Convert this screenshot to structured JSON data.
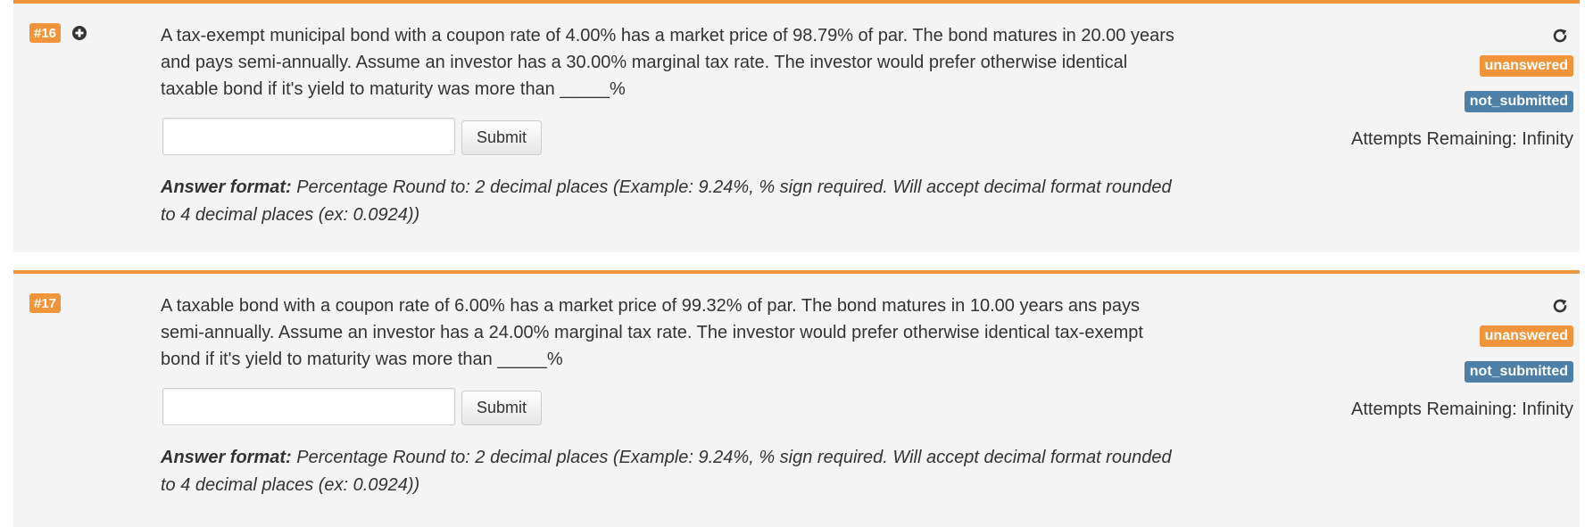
{
  "questions": [
    {
      "number": "#16",
      "text": "A tax-exempt municipal bond with a coupon rate of 4.00% has a market price of 98.79% of par. The bond matures in 20.00 years and pays semi-annually. Assume an investor has a 30.00% marginal tax rate. The investor would prefer otherwise identical taxable bond if it's yield to maturity was more than _____%",
      "answer_value": "",
      "submit_label": "Submit",
      "answer_format_label": "Answer format:",
      "answer_format_text": " Percentage Round to: 2 decimal places (Example: 9.24%, % sign required. Will accept decimal format rounded to 4 decimal places (ex: 0.0924))",
      "status_badge": "unanswered",
      "submission_badge": "not_submitted",
      "attempts": "Attempts Remaining: Infinity",
      "has_plus_icon": true
    },
    {
      "number": "#17",
      "text": "A taxable bond with a coupon rate of 6.00% has a market price of 99.32% of par. The bond matures in 10.00 years ans pays semi-annually. Assume an investor has a 24.00% marginal tax rate. The investor would prefer otherwise identical tax-exempt bond if it's yield to maturity was more than _____%",
      "answer_value": "",
      "submit_label": "Submit",
      "answer_format_label": "Answer format:",
      "answer_format_text": " Percentage Round to: 2 decimal places (Example: 9.24%, % sign required. Will accept decimal format rounded to 4 decimal places (ex: 0.0924))",
      "status_badge": "unanswered",
      "submission_badge": "not_submitted",
      "attempts": "Attempts Remaining: Infinity",
      "has_plus_icon": false
    }
  ],
  "colors": {
    "accent": "#f0953c",
    "badge_blue": "#4e7fa6",
    "panel_bg": "#f4f4f4"
  },
  "icons": {
    "plus": "plus-circle-icon",
    "reload": "reload-icon"
  }
}
